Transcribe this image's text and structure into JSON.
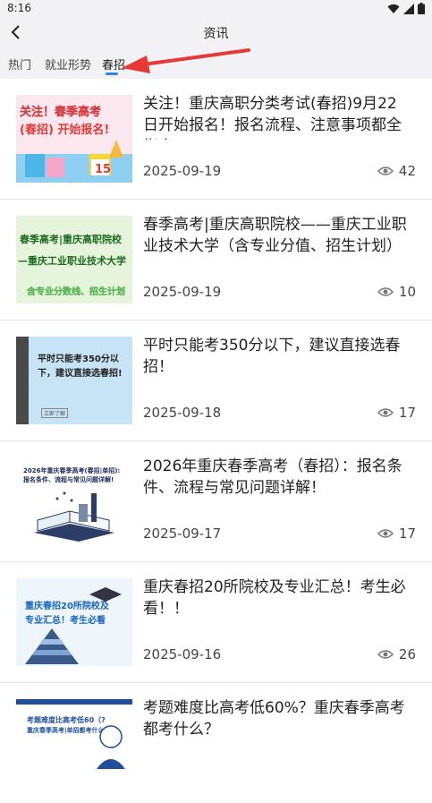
{
  "status_bar": {
    "time": "8:16"
  },
  "header": {
    "title": "资讯"
  },
  "tabs": [
    {
      "label": "热门"
    },
    {
      "label": "就业形势"
    },
    {
      "label": "春招"
    }
  ],
  "articles": [
    {
      "title": "关注！重庆高职分类考试(春招)9月22日开始报名！报名流程、注意事项都全指南",
      "date": "2025-09-19",
      "views": "42",
      "thumb": {
        "line1": "关注！春季高考",
        "line2": "(春招) 开始报名!",
        "badge": "15"
      }
    },
    {
      "title": "春季高考|重庆高职院校——重庆工业职业技术大学（含专业分值、招生计划）",
      "date": "2025-09-19",
      "views": "10",
      "thumb": {
        "line1": "春季高考|重庆高职院校",
        "line2": "—重庆工业职业技术大学",
        "line3": "含专业分数线、招生计划"
      }
    },
    {
      "title": "平时只能考350分以下，建议直接选春招！",
      "date": "2025-09-18",
      "views": "17",
      "thumb": {
        "line1": "平时只能考350分以",
        "line2": "下，建议直接选春招!",
        "line3": "立即了解"
      }
    },
    {
      "title": "2026年重庆春季高考（春招）：报名条件、流程与常见问题详解！",
      "date": "2025-09-17",
      "views": "17",
      "thumb": {
        "line1": "2026年重庆春季高考(春招|单招):",
        "line2": "报名条件、流程与常见问题详解!"
      }
    },
    {
      "title": "重庆春招20所院校及专业汇总！考生必看！！",
      "date": "2025-09-16",
      "views": "26",
      "thumb": {
        "line1": "重庆春招20所院校及",
        "line2": "专业汇总！考生必看"
      }
    },
    {
      "title": "考题难度比高考低60%？重庆春季高考都考什么？",
      "date": "",
      "views": "",
      "thumb": {
        "line1": "考题难度比高考低60（?",
        "line2": "重庆春季高考|单招都考什么?"
      }
    }
  ],
  "colors": {
    "accent": "#2a84f2",
    "annotation_arrow": "#e53935"
  }
}
